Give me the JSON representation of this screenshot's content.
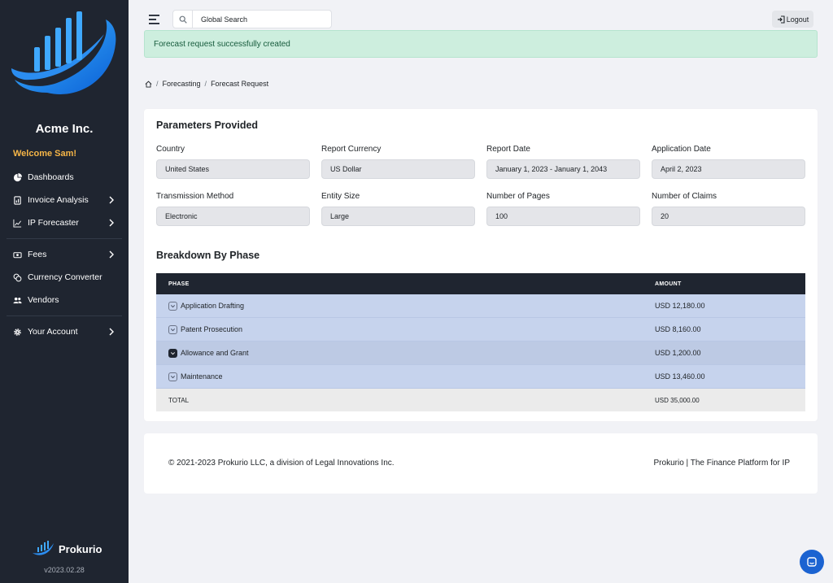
{
  "sidebar": {
    "company": "Acme Inc.",
    "welcome": "Welcome Sam!",
    "items": [
      {
        "label": "Dashboards",
        "icon": "pie-chart-icon",
        "chevron": false
      },
      {
        "label": "Invoice Analysis",
        "icon": "invoice-icon",
        "chevron": true
      },
      {
        "label": "IP Forecaster",
        "icon": "line-chart-icon",
        "chevron": true
      },
      {
        "label": "Fees",
        "icon": "money-icon",
        "chevron": true
      },
      {
        "label": "Currency Converter",
        "icon": "coins-icon",
        "chevron": false
      },
      {
        "label": "Vendors",
        "icon": "users-icon",
        "chevron": false
      },
      {
        "label": "Your Account",
        "icon": "gear-icon",
        "chevron": true
      }
    ],
    "brand": "Prokurio",
    "version": "v2023.02.28"
  },
  "topbar": {
    "search_value": "Global Search",
    "logout_label": "Logout"
  },
  "alert": "Forecast request successfully created",
  "breadcrumb": [
    "Forecasting",
    "Forecast Request"
  ],
  "params": {
    "title": "Parameters Provided",
    "fields": [
      {
        "label": "Country",
        "value": "United States"
      },
      {
        "label": "Report Currency",
        "value": "US Dollar"
      },
      {
        "label": "Report Date",
        "value": "January 1, 2023 - January 1, 2043"
      },
      {
        "label": "Application Date",
        "value": "April 2, 2023"
      },
      {
        "label": "Transmission Method",
        "value": "Electronic"
      },
      {
        "label": "Entity Size",
        "value": "Large"
      },
      {
        "label": "Number of Pages",
        "value": "100"
      },
      {
        "label": "Number of Claims",
        "value": "20"
      }
    ]
  },
  "breakdown": {
    "title": "Breakdown By Phase",
    "col_phase": "PHASE",
    "col_amount": "AMOUNT",
    "rows": [
      {
        "phase": "Application Drafting",
        "amount": "USD 12,180.00"
      },
      {
        "phase": "Patent Prosecution",
        "amount": "USD 8,160.00"
      },
      {
        "phase": "Allowance and Grant",
        "amount": "USD 1,200.00"
      },
      {
        "phase": "Maintenance",
        "amount": "USD 13,460.00"
      }
    ],
    "total_label": "TOTAL",
    "total_amount": "USD 35,000.00"
  },
  "footer": {
    "copyright": "© 2021-2023 Prokurio LLC, a division of Legal Innovations Inc.",
    "tagline": "Prokurio | The Finance Platform for IP"
  },
  "colors": {
    "sidebar_bg": "#1f2530",
    "accent": "#1b63d1",
    "welcome": "#f5b547",
    "alert_bg": "#cdeede",
    "row_bg": "#c6d3ed"
  }
}
